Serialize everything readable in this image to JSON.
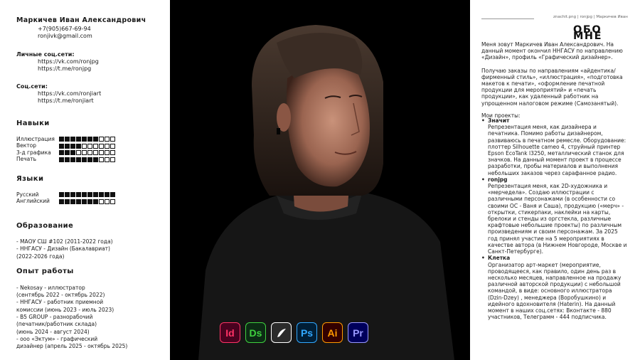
{
  "contacts": {
    "name": "Маркичев Иван Александрович",
    "phone": "+7(905)667-69-94",
    "email": "ronjivk@gmail.com",
    "personal_label": "Личные соц.сети:",
    "personal_links": [
      "https://vk.com/ronjpg",
      "https://t.me/ronjpg"
    ],
    "social_label": "Соц.сети:",
    "social_links": [
      "https://vk.com/ronjiart",
      "https://t.me/ronjiart"
    ]
  },
  "skills": {
    "title": "Навыки",
    "items": [
      {
        "name": "Иллюстрация",
        "level": 7,
        "max": 10
      },
      {
        "name": "Вектор",
        "level": 4,
        "max": 10
      },
      {
        "name": "3-д графика",
        "level": 3,
        "max": 10
      },
      {
        "name": "Печать",
        "level": 7,
        "max": 10
      }
    ]
  },
  "languages": {
    "title": "Языки",
    "items": [
      {
        "name": "Русский",
        "level": 10,
        "max": 10
      },
      {
        "name": "Английский",
        "level": 7,
        "max": 10
      }
    ]
  },
  "education": {
    "title": "Образование",
    "lines": [
      "- МАОУ СШ #102 (2011-2022 года)",
      "- ННГАСУ - Дизайн (Бакалавриат)",
      "(2022-2026 года)"
    ]
  },
  "experience": {
    "title": "Опыт работы",
    "lines": [
      "- Nekosay - иллюстратор",
      "(сентябрь 2022 - октябрь 2022)",
      "- ННГАСУ - работник приемной",
      "комиссии (июнь 2023 - июль 2023)",
      "- B5 GROUP - разнорабочий",
      "(печатник/работник склада)",
      "(июнь 2024 - август 2024)",
      "- ооо «Эктум» - графический",
      "дизайнер (апрель 2025 - октябрь 2025)"
    ]
  },
  "tools": [
    {
      "label": "Id",
      "name": "indesign-icon",
      "bg": "#49021f",
      "fg": "#ff3366"
    },
    {
      "label": "Ds",
      "name": "dimension-icon",
      "bg": "#0c2b14",
      "fg": "#3fd13f"
    },
    {
      "label": "",
      "name": "procreate-icon",
      "bg": "#2b2b2b",
      "fg": "#ffffff"
    },
    {
      "label": "Ps",
      "name": "photoshop-icon",
      "bg": "#001e36",
      "fg": "#31a8ff"
    },
    {
      "label": "Ai",
      "name": "illustrator-icon",
      "bg": "#330000",
      "fg": "#ff9a00"
    },
    {
      "label": "Pr",
      "name": "premiere-icon",
      "bg": "#00005b",
      "fg": "#9999ff"
    }
  ],
  "right": {
    "crumb": "znachit.png | ronjpg | Маркичев Иван",
    "title": "ОБО МНЕ",
    "intro": "Меня зовут Маркичев Иван Александрович. На данный момент окончил ННГАСУ по направлению «Дизайн», профиль «Графический дизайнер».",
    "orders": "Получаю заказы по направлениям «айдентика/фирменный стиль», «иллюстрация», «подготовка макетов к печати», «оформление печатной продукции для мероприятий» и «печать продукции», как удаленный работник на упрощенном налоговом режиме (Самозанятый).",
    "projects_label": "Мои проекты:",
    "projects": [
      {
        "title": "Значит",
        "text": "Репрезентация меня, как дизайнера и печатника. Помимо работы дизайнером, развиваюсь в печатном ремесле. Оборудование: плоттер Silhouette cameo 4, струйный принтер Epson EcoTank l3250, металлический станок для значков. На данный момент проект в процессе разработки, пробы материалов и выполнения небольших заказов через сарафанное радио."
      },
      {
        "title": "ronjpg",
        "text": "Репрезентация меня, как 2D-художника и «мерчеделa». Создаю иллюстрации с различными персонажами (в особенности со своими ОС - Ваня и Саша), продукцию («мерч» - открытки, стикерпаки, наклейки на карты, брелоки и стенды из оргстекла, различные крафтовые небольшие проекты) по различным произведениям и своим персонажам. За 2025 год принял участие на 5 мероприятиях в качестве автора (в Нижнем Новгороде, Москве и Санкт-Петербурге)."
      },
      {
        "title": "Клетка",
        "text": "Организатор арт-маркет (мероприятие, проводящееся, как правило, один день раз в несколько месяцев, направленное на продажу различной авторской продукции) с небольшой командой, в виде: основного иллюстратора (Dzin-Dzey) , менеджера (Воробушкино) и идейного вдохновителя (Haterin). На данный момент в наших соц.сетях: Вконтакте - 880 участников, Телеграмм - 444 подписчика."
      }
    ]
  }
}
